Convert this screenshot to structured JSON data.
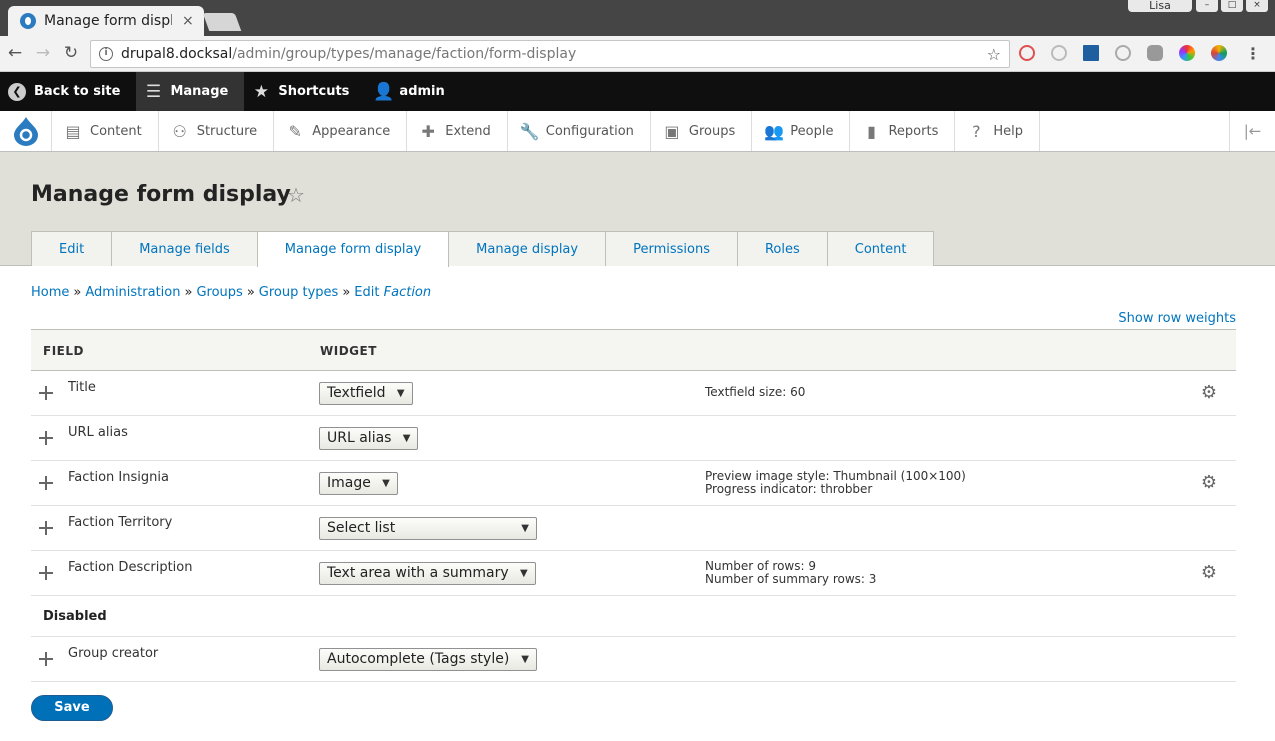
{
  "browser": {
    "tab_title": "Manage form displa",
    "tab_close": "×",
    "user": "Lisa",
    "url_host": "drupal8.docksal",
    "url_path": "/admin/group/types/manage/faction/form-display"
  },
  "toolbar": {
    "back": "Back to site",
    "manage": "Manage",
    "shortcuts": "Shortcuts",
    "user": "admin"
  },
  "tray": {
    "items": [
      "Content",
      "Structure",
      "Appearance",
      "Extend",
      "Configuration",
      "Groups",
      "People",
      "Reports",
      "Help"
    ]
  },
  "page": {
    "title": "Manage form display",
    "tabs": [
      "Edit",
      "Manage fields",
      "Manage form display",
      "Manage display",
      "Permissions",
      "Roles",
      "Content"
    ],
    "active_tab": "Manage form display"
  },
  "breadcrumb": {
    "items": [
      "Home",
      "Administration",
      "Groups",
      "Group types"
    ],
    "last_prefix": "Edit",
    "last_em": "Faction"
  },
  "show_row_weights": "Show row weights",
  "table": {
    "headers": {
      "field": "FIELD",
      "widget": "WIDGET"
    },
    "rows": [
      {
        "field": "Title",
        "widget": "Textfield",
        "summary": [
          "Textfield size: 60"
        ],
        "gear": true
      },
      {
        "field": "URL alias",
        "widget": "URL alias",
        "summary": [],
        "gear": false
      },
      {
        "field": "Faction Insignia",
        "widget": "Image",
        "summary": [
          "Preview image style: Thumbnail (100×100)",
          "Progress indicator: throbber"
        ],
        "gear": true
      },
      {
        "field": "Faction Territory",
        "widget": "Select list",
        "summary": [],
        "gear": false
      },
      {
        "field": "Faction Description",
        "widget": "Text area with a summary",
        "summary": [
          "Number of rows: 9",
          "Number of summary rows: 3"
        ],
        "gear": true
      }
    ],
    "disabled_label": "Disabled",
    "disabled_rows": [
      {
        "field": "Group creator",
        "widget": "Autocomplete (Tags style)"
      }
    ]
  },
  "save_label": "Save",
  "colors": {
    "link": "#0074bd",
    "toolbar": "#0f0f0f",
    "header": "#e0e0d8",
    "button": "#0071b8"
  }
}
